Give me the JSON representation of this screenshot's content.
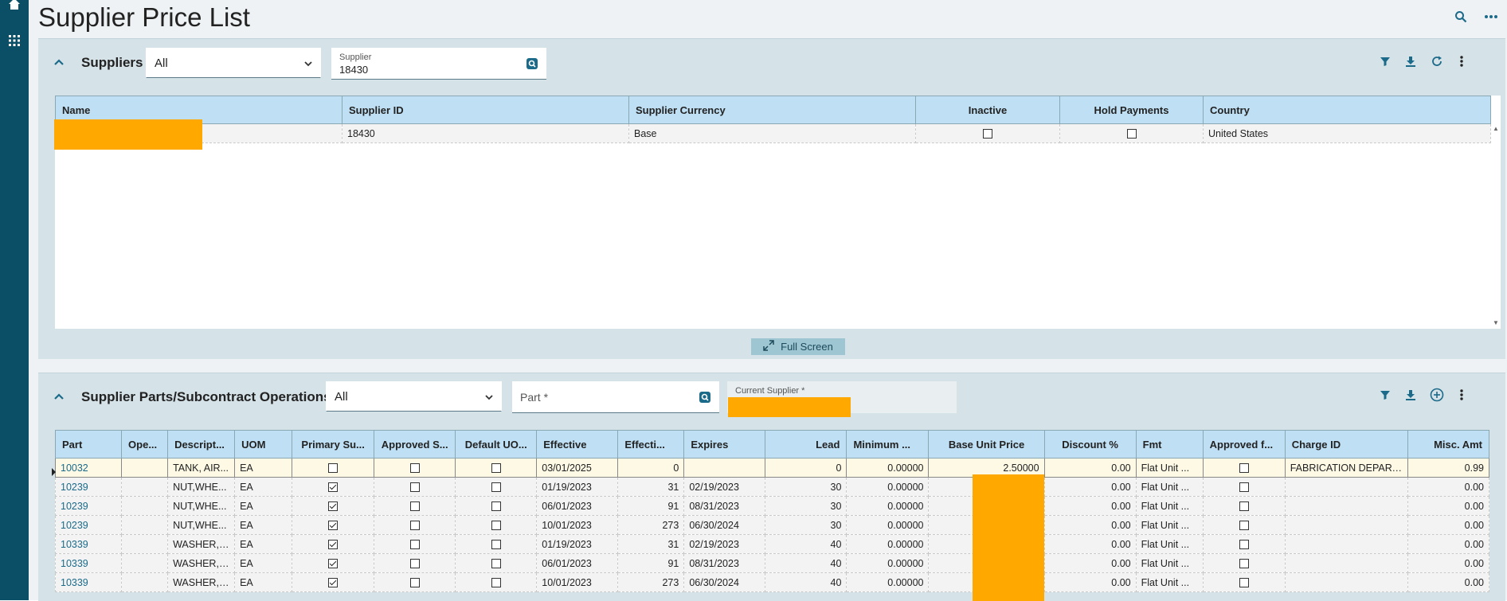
{
  "page": {
    "title": "Supplier Price List"
  },
  "suppliers_panel": {
    "title": "Suppliers",
    "filter_value": "All",
    "supplier_field": {
      "label": "Supplier",
      "value": "18430"
    },
    "fullscreen_label": "Full Screen",
    "columns": [
      "Name",
      "Supplier ID",
      "Supplier Currency",
      "Inactive",
      "Hold Payments",
      "Country"
    ],
    "rows": [
      {
        "name": "",
        "supplier_id": "18430",
        "currency": "Base",
        "inactive": false,
        "hold_payments": false,
        "country": "United States"
      }
    ]
  },
  "parts_panel": {
    "title": "Supplier Parts/Subcontract Operations",
    "filter_value": "All",
    "part_field": {
      "placeholder": "Part *"
    },
    "current_supplier": {
      "label": "Current Supplier *",
      "value": ""
    },
    "columns": [
      "Part",
      "Ope...",
      "Descript...",
      "UOM",
      "Primary Su...",
      "Approved S...",
      "Default UO...",
      "Effective",
      "Effecti...",
      "Expires",
      "Lead",
      "Minimum ...",
      "Base Unit Price",
      "Discount %",
      "Fmt",
      "Approved f...",
      "Charge ID",
      "Misc. Amt"
    ],
    "rows": [
      {
        "part": "10032",
        "op": "",
        "desc": "TANK, AIR...",
        "uom": "EA",
        "primary": false,
        "approved_s": false,
        "default_uo": false,
        "effective": "03/01/2025",
        "effecti": "0",
        "expires": "",
        "lead": "0",
        "minimum": "0.00000",
        "base_unit_price": "2.50000",
        "discount": "0.00",
        "fmt": "Flat Unit ...",
        "approved_f": false,
        "charge_id": "FABRICATION DEPART...",
        "misc_amt": "0.99"
      },
      {
        "part": "10239",
        "op": "",
        "desc": "NUT,WHE...",
        "uom": "EA",
        "primary": true,
        "approved_s": false,
        "default_uo": false,
        "effective": "01/19/2023",
        "effecti": "31",
        "expires": "02/19/2023",
        "lead": "30",
        "minimum": "0.00000",
        "base_unit_price": "",
        "discount": "0.00",
        "fmt": "Flat Unit ...",
        "approved_f": false,
        "charge_id": "",
        "misc_amt": "0.00"
      },
      {
        "part": "10239",
        "op": "",
        "desc": "NUT,WHE...",
        "uom": "EA",
        "primary": true,
        "approved_s": false,
        "default_uo": false,
        "effective": "06/01/2023",
        "effecti": "91",
        "expires": "08/31/2023",
        "lead": "30",
        "minimum": "0.00000",
        "base_unit_price": "",
        "discount": "0.00",
        "fmt": "Flat Unit ...",
        "approved_f": false,
        "charge_id": "",
        "misc_amt": "0.00"
      },
      {
        "part": "10239",
        "op": "",
        "desc": "NUT,WHE...",
        "uom": "EA",
        "primary": true,
        "approved_s": false,
        "default_uo": false,
        "effective": "10/01/2023",
        "effecti": "273",
        "expires": "06/30/2024",
        "lead": "30",
        "minimum": "0.00000",
        "base_unit_price": "",
        "discount": "0.00",
        "fmt": "Flat Unit ...",
        "approved_f": false,
        "charge_id": "",
        "misc_amt": "0.00"
      },
      {
        "part": "10339",
        "op": "",
        "desc": "WASHER, ...",
        "uom": "EA",
        "primary": true,
        "approved_s": false,
        "default_uo": false,
        "effective": "01/19/2023",
        "effecti": "31",
        "expires": "02/19/2023",
        "lead": "40",
        "minimum": "0.00000",
        "base_unit_price": "",
        "discount": "0.00",
        "fmt": "Flat Unit ...",
        "approved_f": false,
        "charge_id": "",
        "misc_amt": "0.00"
      },
      {
        "part": "10339",
        "op": "",
        "desc": "WASHER, ...",
        "uom": "EA",
        "primary": true,
        "approved_s": false,
        "default_uo": false,
        "effective": "06/01/2023",
        "effecti": "91",
        "expires": "08/31/2023",
        "lead": "40",
        "minimum": "0.00000",
        "base_unit_price": "",
        "discount": "0.00",
        "fmt": "Flat Unit ...",
        "approved_f": false,
        "charge_id": "",
        "misc_amt": "0.00"
      },
      {
        "part": "10339",
        "op": "",
        "desc": "WASHER, ...",
        "uom": "EA",
        "primary": true,
        "approved_s": false,
        "default_uo": false,
        "effective": "10/01/2023",
        "effecti": "273",
        "expires": "06/30/2024",
        "lead": "40",
        "minimum": "0.00000",
        "base_unit_price": "",
        "discount": "0.00",
        "fmt": "Flat Unit ...",
        "approved_f": false,
        "charge_id": "",
        "misc_amt": "0.00"
      }
    ]
  },
  "icons": {
    "sidebar": [
      "home-icon",
      "apps-grid-icon"
    ],
    "header": [
      "search-icon",
      "more-icon"
    ],
    "suppliers_toolbar": [
      "filter-icon",
      "download-icon",
      "refresh-icon",
      "more-icon"
    ],
    "parts_toolbar": [
      "filter-icon",
      "download-icon",
      "add-icon",
      "more-icon"
    ]
  },
  "colors": {
    "sidebar": "#0b4f66",
    "header_cell": "#bfe0f4",
    "accent": "#1b6a8a",
    "redaction": "#ffa800"
  }
}
